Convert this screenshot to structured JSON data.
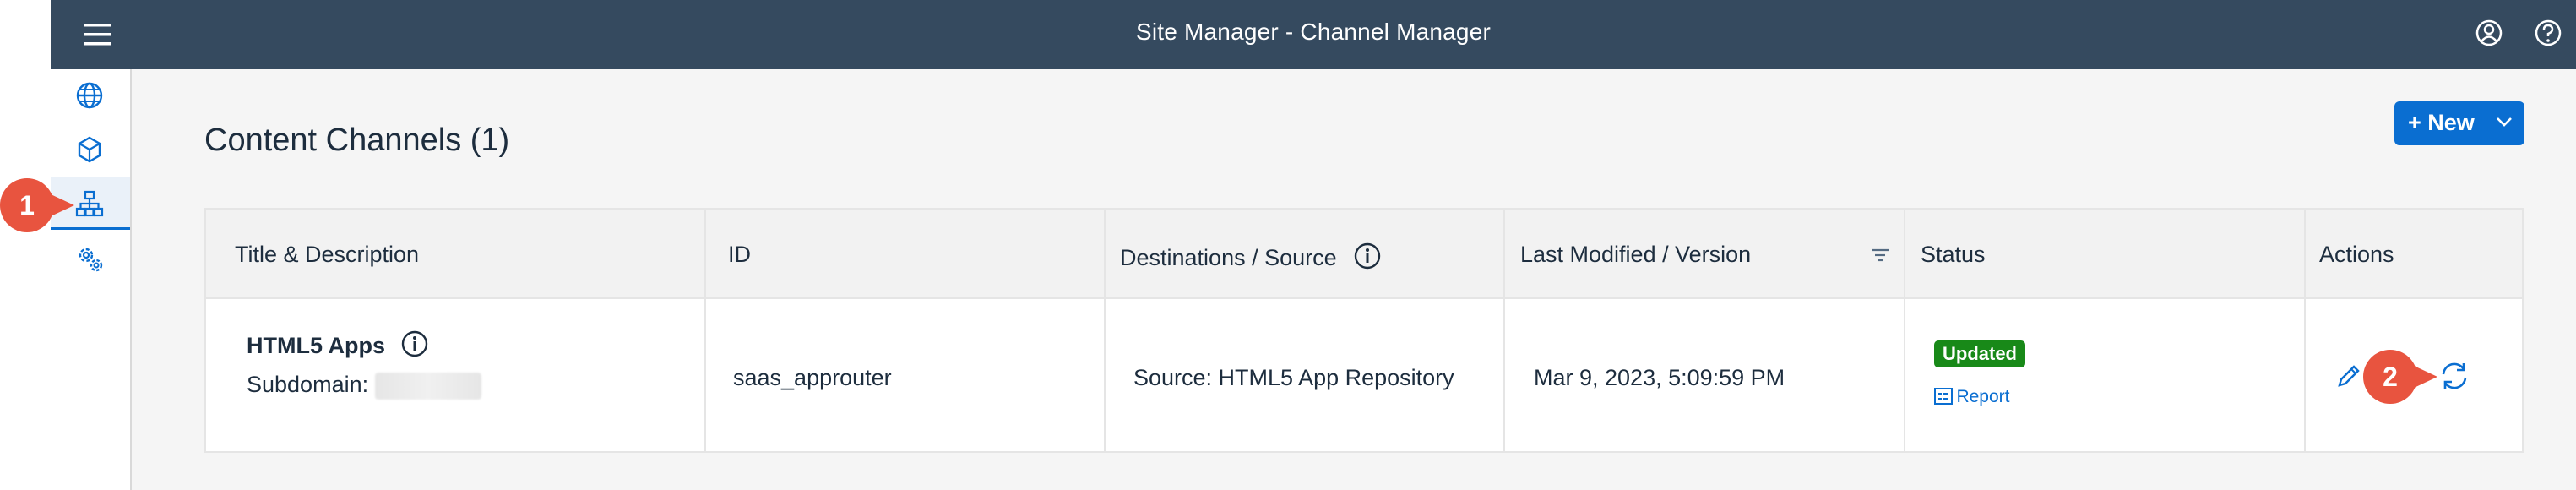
{
  "shellbar": {
    "title": "Site Manager - Channel Manager",
    "menu_icon": "hamburger-menu-icon",
    "user_icon": "user-icon",
    "help_icon": "help-icon",
    "background": "#354a5f"
  },
  "sidenav": {
    "items": [
      {
        "icon": "globe-icon"
      },
      {
        "icon": "cube-icon"
      },
      {
        "icon": "hierarchy-icon",
        "selected": true
      },
      {
        "icon": "settings-gears-icon"
      }
    ]
  },
  "markers": {
    "one": "1",
    "two": "2",
    "color": "#e8543f"
  },
  "main": {
    "title": "Content Channels (1)",
    "new_button": {
      "label": "+ New"
    }
  },
  "table": {
    "columns": {
      "title": "Title & Description",
      "id": "ID",
      "destinations": "Destinations / Source",
      "modified": "Last Modified / Version",
      "status": "Status",
      "actions": "Actions"
    },
    "rows": [
      {
        "title": "HTML5 Apps",
        "subdomain_label": "Subdomain:",
        "id": "saas_approuter",
        "source": "Source: HTML5 App Repository",
        "modified": "Mar 9, 2023, 5:09:59 PM",
        "status": "Updated",
        "report_link": "Report"
      }
    ]
  },
  "colors": {
    "accent": "#0a6ed1",
    "status_success": "#188918"
  }
}
